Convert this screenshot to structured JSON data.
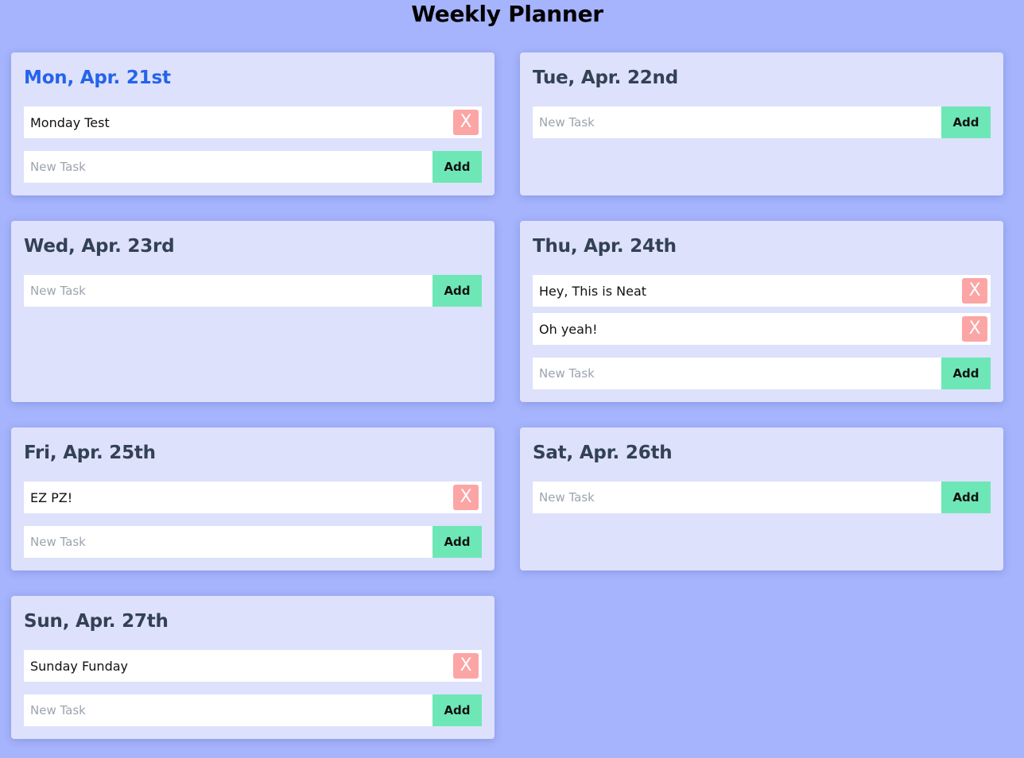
{
  "title": "Weekly Planner",
  "colors": {
    "background": "#a5b4fc",
    "card": "#dde1fb",
    "today_heading": "#2563eb",
    "heading": "#334155",
    "delete_button": "#fca5a5",
    "add_button": "#6ee7b7"
  },
  "icons": {
    "delete": "close-icon"
  },
  "days": [
    {
      "heading": "Mon, Apr. 21st",
      "today": true,
      "tasks": [
        "Monday Test"
      ],
      "input_placeholder": "New Task",
      "add_label": "Add",
      "delete_label": "X"
    },
    {
      "heading": "Tue, Apr. 22nd",
      "today": false,
      "tasks": [],
      "input_placeholder": "New Task",
      "add_label": "Add",
      "delete_label": "X"
    },
    {
      "heading": "Wed, Apr. 23rd",
      "today": false,
      "tasks": [],
      "input_placeholder": "New Task",
      "add_label": "Add",
      "delete_label": "X"
    },
    {
      "heading": "Thu, Apr. 24th",
      "today": false,
      "tasks": [
        "Hey, This is Neat",
        "Oh yeah!"
      ],
      "input_placeholder": "New Task",
      "add_label": "Add",
      "delete_label": "X"
    },
    {
      "heading": "Fri, Apr. 25th",
      "today": false,
      "tasks": [
        "EZ PZ!"
      ],
      "input_placeholder": "New Task",
      "add_label": "Add",
      "delete_label": "X"
    },
    {
      "heading": "Sat, Apr. 26th",
      "today": false,
      "tasks": [],
      "input_placeholder": "New Task",
      "add_label": "Add",
      "delete_label": "X"
    },
    {
      "heading": "Sun, Apr. 27th",
      "today": false,
      "tasks": [
        "Sunday Funday"
      ],
      "input_placeholder": "New Task",
      "add_label": "Add",
      "delete_label": "X"
    }
  ]
}
